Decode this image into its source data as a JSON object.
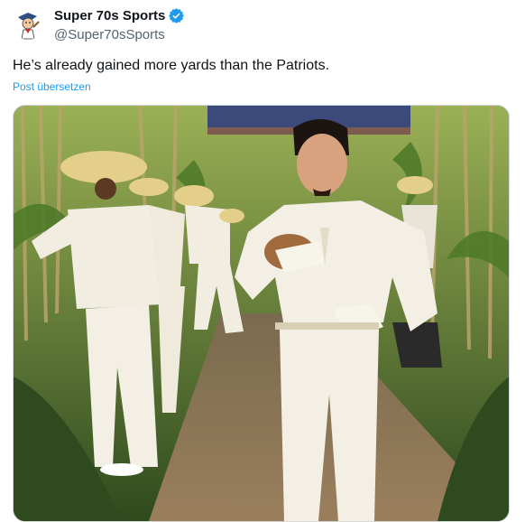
{
  "author": {
    "display_name": "Super 70s Sports",
    "handle": "@Super70sSports",
    "avatar_icon": "mascot-avatar-icon",
    "verified_icon": "verified-badge-icon",
    "verified_color": "#1d9bf0"
  },
  "post": {
    "text": "He’s already gained more yards than the Patriots.",
    "translate_label": "Post übersetzen"
  },
  "media": {
    "kind": "photo"
  },
  "colors": {
    "text_primary": "#0f1419",
    "text_secondary": "#536471",
    "link": "#1d9bf0",
    "border": "#cfd9de"
  }
}
